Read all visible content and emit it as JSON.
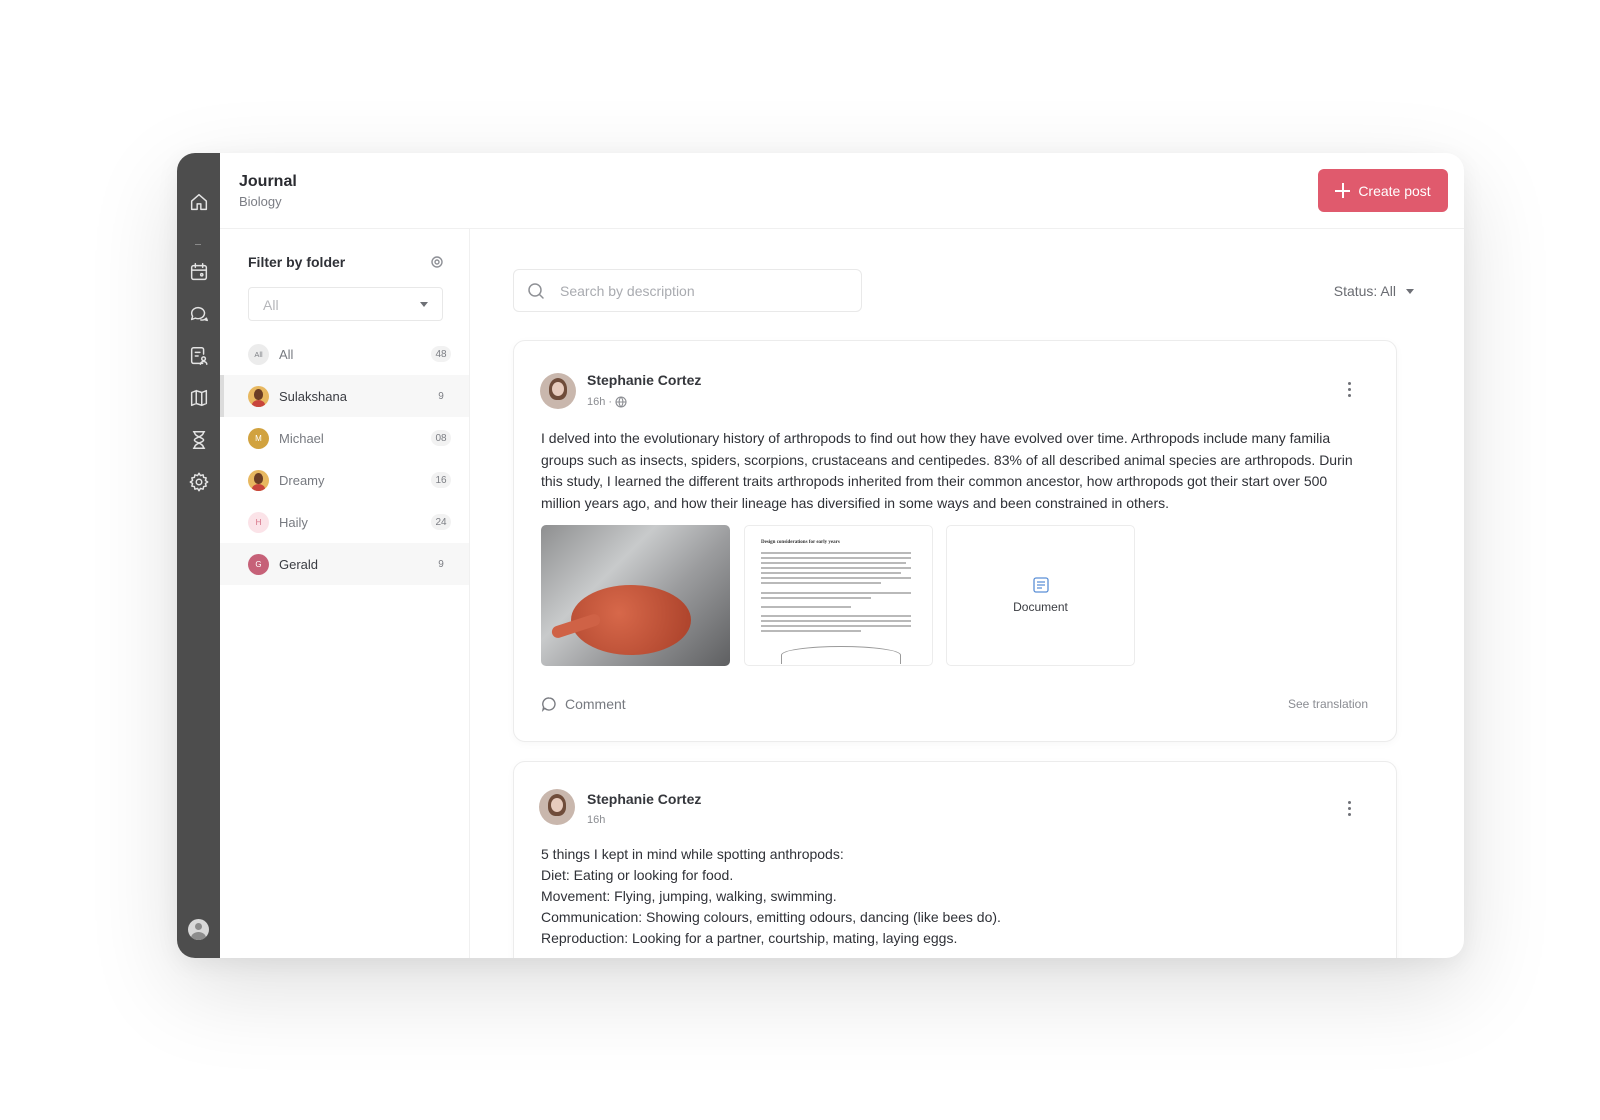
{
  "header": {
    "title": "Journal",
    "subtitle": "Biology",
    "create_button": "Create post"
  },
  "rail": {
    "icons": [
      "home-icon",
      "calendar-icon",
      "chat-icon",
      "clipboard-user-icon",
      "map-icon",
      "hourglass-icon",
      "gear-icon",
      "user-avatar"
    ]
  },
  "folders": {
    "title": "Filter by folder",
    "select_value": "All",
    "items": [
      {
        "initial": "All",
        "name": "All",
        "count": "48"
      },
      {
        "initial": "",
        "name": "Sulakshana",
        "count": "9"
      },
      {
        "initial": "M",
        "name": "Michael",
        "count": "08"
      },
      {
        "initial": "",
        "name": "Dreamy",
        "count": "16"
      },
      {
        "initial": "H",
        "name": "Haily",
        "count": "24"
      },
      {
        "initial": "G",
        "name": "Gerald",
        "count": "9"
      }
    ]
  },
  "search": {
    "placeholder": "Search by description"
  },
  "status_filter": "Status: All",
  "posts": [
    {
      "author": "Stephanie Cortez",
      "time": "16h ·",
      "lines": [
        "I delved into the evolutionary history of arthropods to find out how they have evolved over time. Arthropods include many familia",
        "groups such as insects, spiders, scorpions, crustaceans and centipedes. 83% of all described animal species are arthropods. Durin",
        "this study, I learned the different traits arthropods inherited from their common ancestor, how arthropods got their start over 500",
        "million years ago, and how their lineage has diversified in some ways and been constrained in others."
      ],
      "doc_heading": "Design considerations for early years",
      "attachment_label": "Document",
      "comment_label": "Comment",
      "translation_label": "See translation"
    },
    {
      "author": "Stephanie Cortez",
      "time": "16h",
      "lines": [
        "5 things I kept in mind while spotting anthropods:",
        "Diet: Eating or looking for food.",
        "Movement: Flying, jumping, walking, swimming.",
        "Communication: Showing colours, emitting odours, dancing (like bees do).",
        "Reproduction: Looking for a partner, courtship, mating, laying eggs."
      ]
    }
  ],
  "colors": {
    "rail": "#4d4d4d",
    "accent": "#e05a6d",
    "background": "#ffffff"
  }
}
